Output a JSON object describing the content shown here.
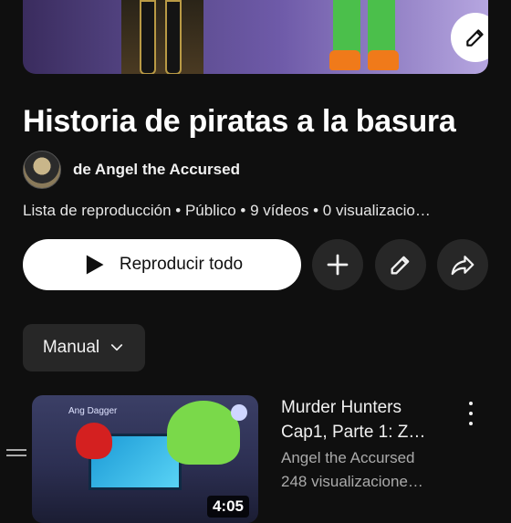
{
  "playlist": {
    "title": "Historia de piratas a la basura",
    "owner": "de Angel the Accursed",
    "meta": "Lista de reproducción • Público • 9 vídeos • 0 visualizacio…"
  },
  "actions": {
    "play_all_label": "Reproducir todo"
  },
  "sort": {
    "selected": "Manual"
  },
  "videos": [
    {
      "title_line1": "Murder Hunters",
      "title_line2": "Cap1, Parte 1: Z…",
      "channel": "Angel the Accursed",
      "views": "248 visualizacione…",
      "duration": "4:05",
      "thumb_tag": "Ang Dagger"
    }
  ],
  "colors": {
    "background": "#0f0f0f",
    "primary_button": "#ffffff",
    "secondary_button": "#272727"
  },
  "icons": {
    "edit": "pencil-icon",
    "add": "plus-icon",
    "share": "share-icon",
    "play": "play-icon",
    "sort": "chevron-down-icon",
    "menu": "more-vert-icon",
    "drag": "drag-handle-icon"
  }
}
